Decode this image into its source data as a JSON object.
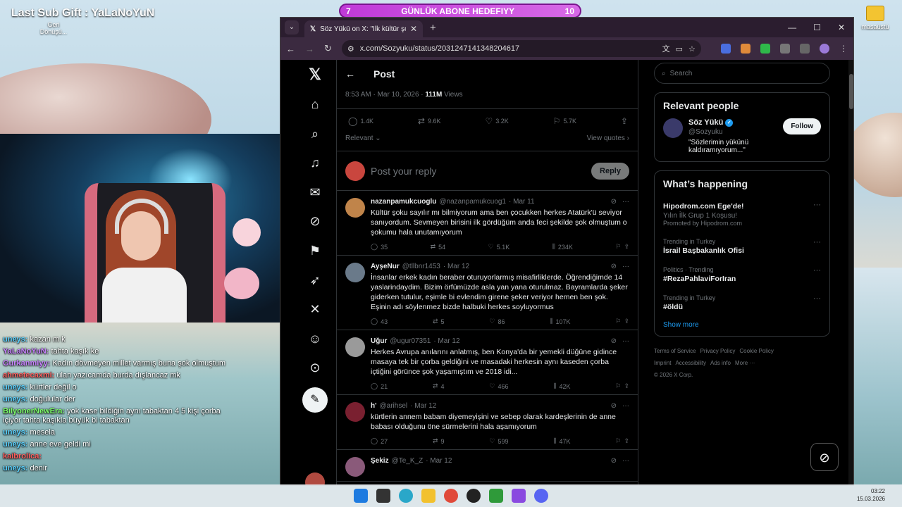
{
  "desktop": {
    "overlay_title": "Last Sub Gift : YaLaNoYuN",
    "recycle_label": "Geri Dönüşü...",
    "desktop_folder_label": "masaüstü",
    "goal": {
      "left": "7",
      "label": "GÜNLÜK ABONE HEDEFIYY",
      "right": "10"
    }
  },
  "chat": [
    {
      "name": "uneys:",
      "text": "kazan m k",
      "color": "blue"
    },
    {
      "name": "YaLaNoYuN:",
      "text": "tahta kaşık ke",
      "color": "pur"
    },
    {
      "name": "Gurkanmiyy:",
      "text": "Kadın dövmeyen millet varmış buna şok olmuştum",
      "color": "pur"
    },
    {
      "name": "ahmetecaxmi:",
      "text": "ulan yazıcamda burda dışlancaz mk",
      "color": "red"
    },
    {
      "name": "uneys:",
      "text": "kürtler değil o",
      "color": "blue"
    },
    {
      "name": "uneys:",
      "text": "doğulular der",
      "color": "blue"
    },
    {
      "name": "BilyonerNewEra:",
      "text": "yok kase bildiğin aynı tabaktan 4 5 kişi çorba içiyor tahta kaşıkla büyük bi tabaktan",
      "color": "grn"
    },
    {
      "name": "uneys:",
      "text": "mesela",
      "color": "blue"
    },
    {
      "name": "uneys:",
      "text": "anne eve geldi mi",
      "color": "blue"
    },
    {
      "name": "kaibrolica:",
      "text": "",
      "color": "red"
    },
    {
      "name": "uneys:",
      "text": "denir",
      "color": "blue"
    }
  ],
  "browser": {
    "tab_title": "Söz Yükü on X: \"İlk kültür şokunuz",
    "url": "x.com/Sozyuku/status/2031247141348204617"
  },
  "x": {
    "header_title": "Post",
    "meta": {
      "time": "8:53 AM · Mar 10, 2026 · ",
      "views_num": "111M",
      "views_label": " Views"
    },
    "actions": {
      "replies": "1.4K",
      "reposts": "9.6K",
      "likes": "3.2K",
      "bookmarks": "5.7K"
    },
    "filter": {
      "sort": "Relevant",
      "quotes": "View quotes"
    },
    "compose": {
      "placeholder": "Post your reply",
      "button": "Reply"
    },
    "tweets": [
      {
        "name": "nazanpamukcuoglu",
        "handle": "@nazanpamukcuog1",
        "date": "· Mar 11",
        "text": "Kültür şoku sayılır mı bilmiyorum ama ben çocukken herkes Atatürk'ü seviyor sanıyordum. Sevmeyen birisini ilk gördüğüm anda feci şekilde şok olmuştum o şokumu hala unutamıyorum",
        "replies": "35",
        "reposts": "54",
        "likes": "5.1K",
        "views": "234K",
        "avatar": "#c0844a"
      },
      {
        "name": "AyşeNur",
        "handle": "@tllbnr1453",
        "date": "· Mar 12",
        "text": "İnsanlar erkek kadın beraber oturuyorlarmış misafirliklerde. Öğrendiğimde 14 yaslarindaydim. Bizim örfümüzde asla yan yana oturulmaz. Bayramlarda şeker giderken tutulur, eşimle bi evlendim girene şeker veriyor hemen ben şok. Eşinin adı söylenmez bizde halbuki herkes soyluyormus",
        "replies": "43",
        "reposts": "5",
        "likes": "86",
        "views": "107K",
        "avatar": "#6a7a8a"
      },
      {
        "name": "Uğur",
        "handle": "@ugur07351",
        "date": "· Mar 12",
        "text": "Herkes Avrupa anılarını anlatmış, ben Konya'da bir yemekli düğüne gidince masaya tek bir çorba geldiğini ve masadaki herkesin aynı kaseden çorba içtiğini görünce şok yaşamıştım ve 2018 idi...",
        "replies": "21",
        "reposts": "4",
        "likes": "466",
        "views": "42K",
        "avatar": "#9a9a9a"
      },
      {
        "name": "h'",
        "handle": "@arihsel",
        "date": "· Mar 12",
        "text": "kürtlerin annem babam diyemeyişini ve sebep olarak kardeşlerinin de anne babası olduğunu öne sürmelerini hala aşamıyorum",
        "replies": "27",
        "reposts": "9",
        "likes": "599",
        "views": "47K",
        "avatar": "#7a2030"
      },
      {
        "name": "Şekiz",
        "handle": "@Te_K_Z",
        "date": "· Mar 12",
        "text": "",
        "replies": "",
        "reposts": "",
        "likes": "",
        "views": "",
        "avatar": "#8a5a7a"
      }
    ],
    "search_placeholder": "Search",
    "relevant": {
      "title": "Relevant people",
      "name": "Söz Yükü",
      "handle": "@Sozyuku",
      "bio": "\"Sözlerimin yükünü kaldıramıyorum...\"",
      "follow": "Follow"
    },
    "happening": {
      "title": "What’s happening",
      "items": [
        {
          "label": "Hipodrom.com Ege'de!",
          "sub": "Yılın İlk Grup 1 Koşusu!",
          "meta": "Promoted by Hipodrom.com",
          "promoted": true
        },
        {
          "label": "Trending in Turkey",
          "tt": "İsrail Başbakanlık Ofisi"
        },
        {
          "label": "Politics · Trending",
          "tt": "#RezaPahlaviForIran"
        },
        {
          "label": "Trending in Turkey",
          "tt": "#öldü"
        }
      ],
      "show_more": "Show more"
    },
    "footer": {
      "l1": [
        "Terms of Service",
        "Privacy Policy",
        "Cookie Policy"
      ],
      "l2": [
        "Imprint",
        "Accessibility",
        "Ads info",
        "More ···"
      ],
      "copy": "© 2026 X Corp."
    }
  },
  "taskbar": {
    "time": "03:22",
    "date": "15.03.2026"
  }
}
